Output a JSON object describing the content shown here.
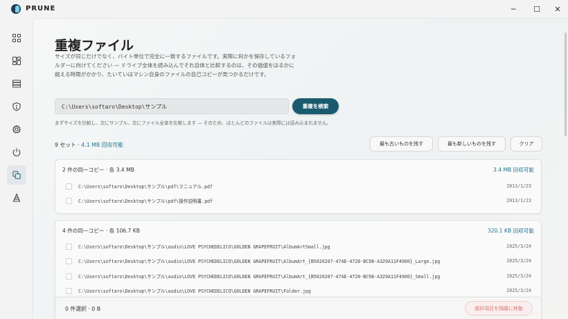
{
  "app": {
    "name": "PRUNE"
  },
  "window_controls": {
    "minimize": "─",
    "maximize": "☐",
    "close": "✕"
  },
  "sidebar": {
    "items": [
      {
        "icon": "dashboard-icon",
        "active": false
      },
      {
        "icon": "layout-icon",
        "active": false
      },
      {
        "icon": "storage-icon",
        "active": false
      },
      {
        "icon": "shield-icon",
        "active": false
      },
      {
        "icon": "gear-icon",
        "active": false
      },
      {
        "icon": "power-icon",
        "active": false
      },
      {
        "icon": "copy-icon",
        "active": true
      },
      {
        "icon": "triangle-icon",
        "active": false
      }
    ]
  },
  "page": {
    "title": "重複ファイル",
    "description": "サイズが同じだけでなく、バイト単位で完全に一致するファイルです。実際に何かを保存しているフォルダーに向けてください — ドライブ全体を読み込んでそれ自体と比較するのは、その価値をはるかに超える時間がかかり、たいていはマシン自身のファイルの自己コピーが見つかるだけです。",
    "path_value": "C:\\Users\\softaro\\Desktop\\サンプル",
    "search_button": "重複を検索",
    "hint": "まずサイズを比較し、次にサンプル、次にファイル全体を比較します — そのため、ほとんどのファイルは実際には読み込まれません。"
  },
  "summary": {
    "sets": "9 セット ·",
    "reclaimable": "4.1 MB 回収可能"
  },
  "actions": {
    "keep_oldest": "最も古いものを残す",
    "keep_newest": "最も新しいものを残す",
    "clear": "クリア"
  },
  "groups": [
    {
      "title": "2 件の同一コピー · 各 3.4 MB",
      "reclaim": "3.4 MB 回収可能",
      "files": [
        {
          "path": "C:\\Users\\softaro\\Desktop\\サンプル\\pdf\\マニュアル.pdf",
          "date": "2013/1/23"
        },
        {
          "path": "C:\\Users\\softaro\\Desktop\\サンプル\\pdf\\操作説明書.pdf",
          "date": "2013/1/23"
        }
      ]
    },
    {
      "title": "4 件の同一コピー · 各 106.7 KB",
      "reclaim": "320.1 KB 回収可能",
      "files": [
        {
          "path": "C:\\Users\\softaro\\Desktop\\サンプル\\audio\\LOVE PSYCHEDELICO\\GOLDEN GRAPEFRUIT\\AlbumArtSmall.jpg",
          "date": "2025/3/24"
        },
        {
          "path": "C:\\Users\\softaro\\Desktop\\サンプル\\audio\\LOVE PSYCHEDELICO\\GOLDEN GRAPEFRUIT\\AlbumArt_{B5020207-474E-4720-BC98-A329A11F4900}_Large.jpg",
          "date": "2025/3/24"
        },
        {
          "path": "C:\\Users\\softaro\\Desktop\\サンプル\\audio\\LOVE PSYCHEDELICO\\GOLDEN GRAPEFRUIT\\AlbumArt_{B5020207-474E-4720-BC98-A329A11F4900}_Small.jpg",
          "date": "2025/3/24"
        },
        {
          "path": "C:\\Users\\softaro\\Desktop\\サンプル\\audio\\LOVE PSYCHEDELICO\\GOLDEN GRAPEFRUIT\\Folder.jpg",
          "date": "2025/3/24"
        }
      ]
    }
  ],
  "footer": {
    "selected": "0 件選択 · 0 B",
    "move_button": "選択項目を隔離に移動"
  }
}
